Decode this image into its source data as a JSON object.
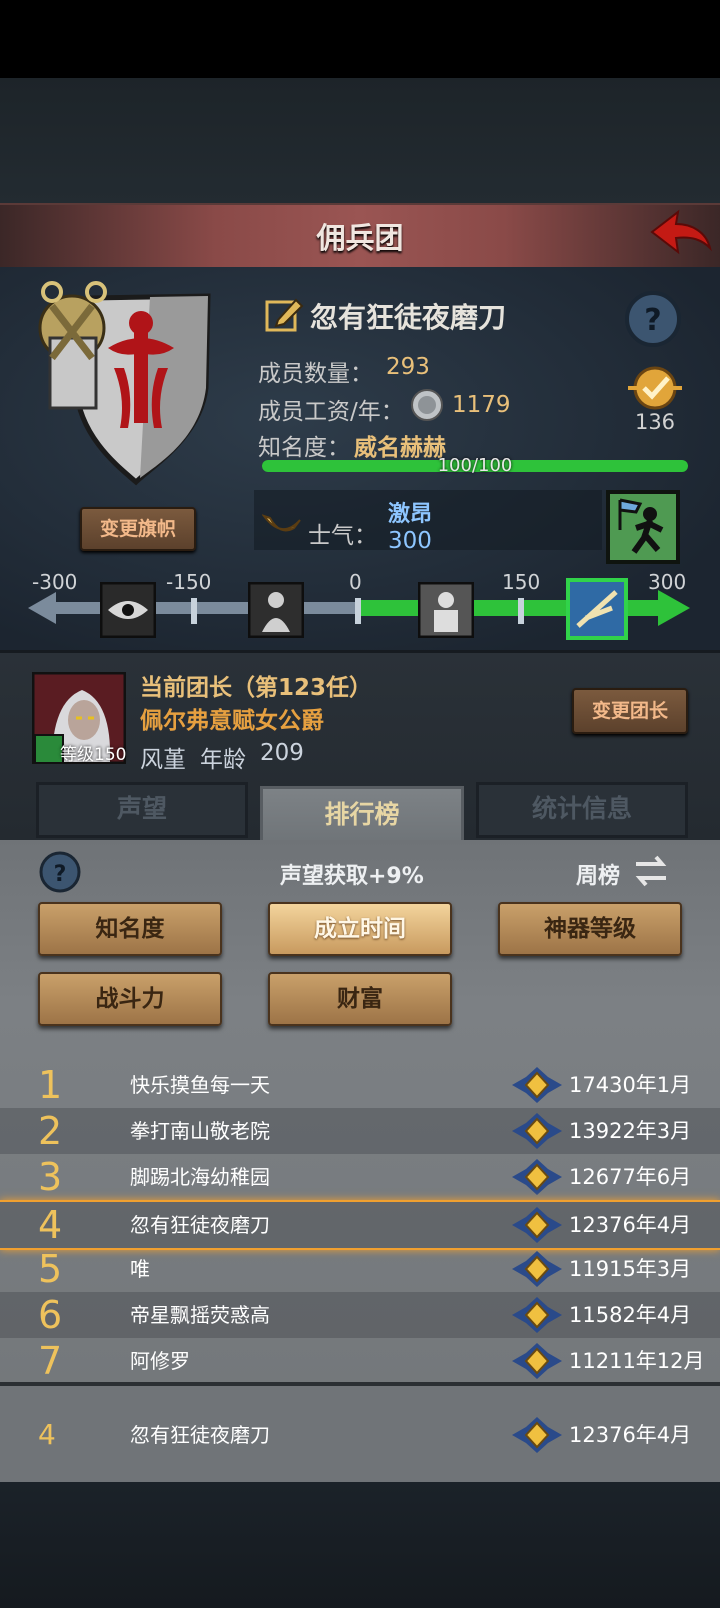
{
  "title": "佣兵团",
  "guild": {
    "name": "忽有狂徒夜磨刀",
    "members_label": "成员数量：",
    "members_value": "293",
    "wage_label": "成员工资/年：",
    "wage_value": "1179",
    "fame_label": "知名度：",
    "fame_value": "威名赫赫",
    "fame_progress_text": "100/100",
    "fame_progress": 1.0,
    "badge_count": "136",
    "change_flag_label": "变更旗帜",
    "morale_label": "士气：",
    "morale_state": "激昂",
    "morale_value": "300"
  },
  "morale_scale": {
    "ticks": [
      "-300",
      "-150",
      "0",
      "150",
      "300"
    ],
    "current": 300,
    "min": -300,
    "max": 300
  },
  "leader": {
    "term_label": "当前团长（第123任）",
    "name": "佩尔弗意赋女公爵",
    "level_label": "等级150",
    "trait": "风堇",
    "age_label": "年龄",
    "age_value": "209",
    "change_leader_label": "变更团长"
  },
  "tabs": [
    {
      "label": "声望",
      "active": false
    },
    {
      "label": "排行榜",
      "active": true
    },
    {
      "label": "统计信息",
      "active": false
    }
  ],
  "ranking": {
    "bonus_text": "声望获取+9%",
    "period_label": "周榜",
    "filters": [
      {
        "label": "知名度",
        "selected": false
      },
      {
        "label": "成立时间",
        "selected": true
      },
      {
        "label": "神器等级",
        "selected": false
      },
      {
        "label": "战斗力",
        "selected": false
      },
      {
        "label": "财富",
        "selected": false
      }
    ],
    "rows": [
      {
        "rank": "1",
        "name": "快乐摸鱼每一天",
        "value": "17430年1月"
      },
      {
        "rank": "2",
        "name": "拳打南山敬老院",
        "value": "13922年3月"
      },
      {
        "rank": "3",
        "name": "脚踢北海幼稚园",
        "value": "12677年6月"
      },
      {
        "rank": "4",
        "name": "忽有狂徒夜磨刀",
        "value": "12376年4月",
        "highlight": true
      },
      {
        "rank": "5",
        "name": "唯",
        "value": "11915年3月"
      },
      {
        "rank": "6",
        "name": "帝星飘摇荧惑高",
        "value": "11582年4月"
      },
      {
        "rank": "7",
        "name": "阿修罗",
        "value": "11211年12月"
      }
    ],
    "self_row": {
      "rank": "4",
      "name": "忽有狂徒夜磨刀",
      "value": "12376年4月"
    }
  },
  "colors": {
    "accent_gold": "#e9c07a",
    "progress_green": "#2ec23a",
    "highlight": "#f0a030"
  }
}
